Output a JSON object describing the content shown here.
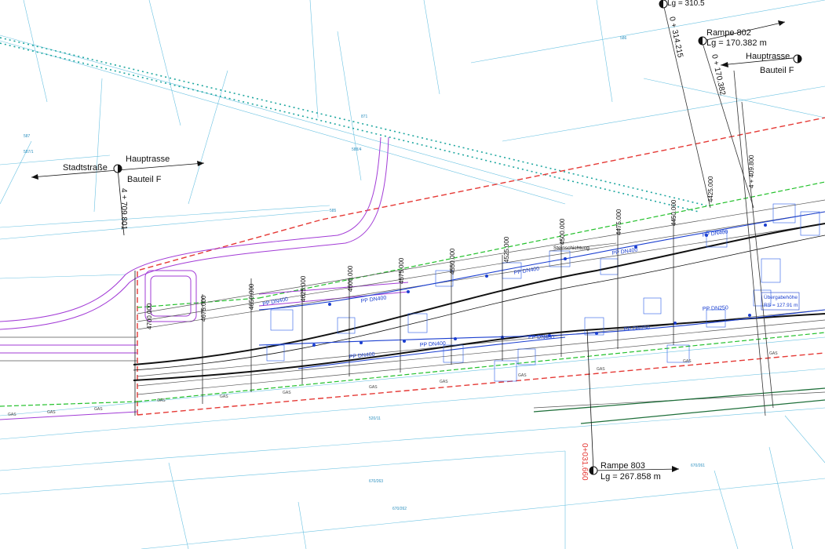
{
  "colors": {
    "cadastral": "#3aaed8",
    "property_line": "#e53935",
    "green_line": "#22c02a",
    "purple": "#a23bd6",
    "pipe_blue": "#1b3fd0",
    "road": "#111111"
  },
  "sections": {
    "left": {
      "left_label": "Stadtstraße",
      "right_label": "Hauptrasse",
      "sub_label": "Bauteil F",
      "chainage": "4 + 709.801"
    },
    "top_right": {
      "label": "Hauptrasse",
      "sub_label": "Bauteil F"
    },
    "rampe802": {
      "title": "Rampe 802",
      "length": "Lg = 170.382 m",
      "chainage_a": "0 + 314.215",
      "chainage_b": "0 + 170.382"
    },
    "rampe803": {
      "title": "Rampe 803",
      "length": "Lg = 267.858 m",
      "chainage": "0+031.660"
    },
    "top_cut": "Lg = 310.5"
  },
  "stations": [
    "4700.000",
    "4675.000",
    "4650.000",
    "4625.000",
    "4600.000",
    "4575.000",
    "4550.000",
    "4525.000",
    "4500.000",
    "4475.000",
    "4450.000",
    "4425.000",
    "4 + 409.800"
  ],
  "pipe_labels": [
    "PP DN400",
    "PP DN400",
    "PP DN400",
    "PP DN400",
    "PP DN400",
    "PP DN400",
    "PP DN400",
    "PP DN250",
    "PP DN250",
    "PP DN400"
  ],
  "notes": {
    "transition": "Übergabehöhe",
    "radius": "RS = 127.91 m",
    "steinschichtung": "Steinschichtung",
    "gas": "GAS"
  },
  "parcels": [
    "587",
    "585",
    "588/4",
    "587/1",
    "670/263",
    "670/262",
    "670/261",
    "520/11",
    "586",
    "871"
  ]
}
